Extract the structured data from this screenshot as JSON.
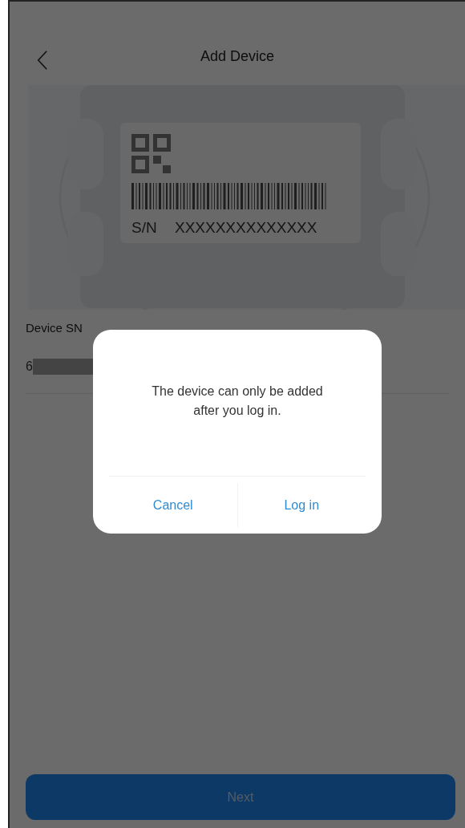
{
  "header": {
    "title": "Add Device"
  },
  "illustration": {
    "sn_label": "S/N",
    "sn_value": "XXXXXXXXXXXXXX"
  },
  "device_sn": {
    "label": "Device SN",
    "value": "6"
  },
  "next_button": {
    "label": "Next"
  },
  "dialog": {
    "message": "The device can only be added after you log in.",
    "buttons": [
      {
        "label": "Cancel"
      },
      {
        "label": "Log in"
      }
    ]
  }
}
